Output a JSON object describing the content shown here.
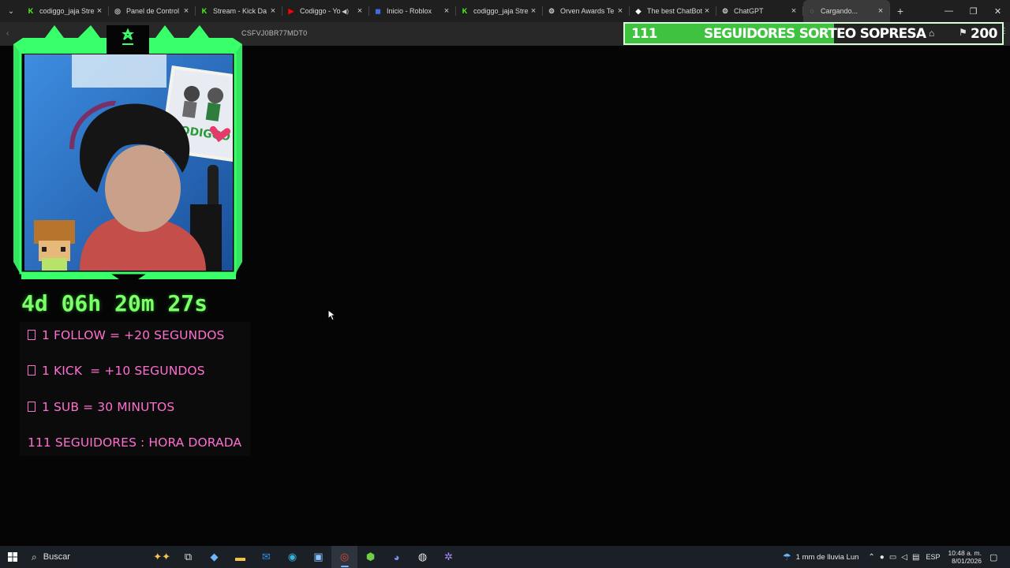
{
  "browser": {
    "tabs": [
      {
        "title": "codiggo_jaja Stre",
        "favicon": "kick-icon",
        "fav_color": "#53fc18",
        "active": false
      },
      {
        "title": "Panel de Control",
        "favicon": "globe-icon",
        "fav_color": "#cccccc",
        "active": false
      },
      {
        "title": "Stream - Kick Da",
        "favicon": "kick-icon",
        "fav_color": "#53fc18",
        "active": false
      },
      {
        "title": "Codiggo - Yo",
        "favicon": "youtube-icon",
        "fav_color": "#ff0000",
        "active": false,
        "audio": true
      },
      {
        "title": "Inicio - Roblox",
        "favicon": "roblox-icon",
        "fav_color": "#3c6ce0",
        "active": false
      },
      {
        "title": "codiggo_jaja Stre",
        "favicon": "kick-icon",
        "fav_color": "#53fc18",
        "active": false
      },
      {
        "title": "Orven Awards Te",
        "favicon": "chatgpt-icon",
        "fav_color": "#cccccc",
        "active": false
      },
      {
        "title": "The best ChatBot",
        "favicon": "diamond-icon",
        "fav_color": "#ffffff",
        "active": false
      },
      {
        "title": "ChatGPT",
        "favicon": "chatgpt-icon",
        "fav_color": "#cccccc",
        "active": false
      },
      {
        "title": "Cargando...",
        "favicon": "loading-icon",
        "fav_color": "#9ab8ff",
        "active": true
      }
    ],
    "url_fragment": "CSFVJ0BR77MDT0"
  },
  "overlay": {
    "goal": {
      "current": "111",
      "title": "SEGUIDORES SORTEO SOPRESA",
      "target": "200",
      "progress": 0.555,
      "fill_color": "#3fc23f"
    },
    "timer": "4d 06h 20m 27s",
    "rules": [
      {
        "text": "1 FOLLOW = +20 SEGUNDOS",
        "boxed": true
      },
      {
        "text": "1 KICK  = +10 SEGUNDOS",
        "boxed": true
      },
      {
        "text": "1 SUB = 30 MINUTOS",
        "boxed": true
      },
      {
        "text": "111 SEGUIDORES : HORA DORADA",
        "boxed": false
      }
    ],
    "accent_green": "#39ff6a",
    "rule_color": "#ff6fd0"
  },
  "taskbar": {
    "search_placeholder": "Buscar",
    "weather": "1 mm de lluvia Lun",
    "language": "ESP",
    "time": "10:48 a. m.",
    "date": "8/01/2026"
  }
}
